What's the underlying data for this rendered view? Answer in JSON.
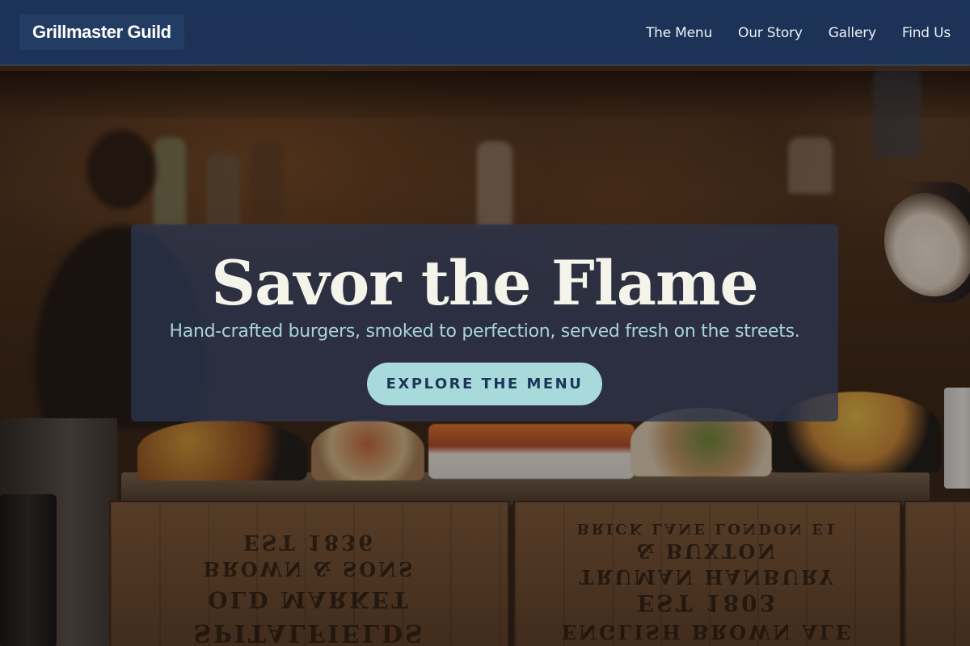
{
  "brand": {
    "name": "Grillmaster Guild"
  },
  "nav": {
    "items": [
      {
        "label": "The Menu"
      },
      {
        "label": "Our Story"
      },
      {
        "label": "Gallery"
      },
      {
        "label": "Find Us"
      }
    ]
  },
  "hero": {
    "title": "Savor the Flame",
    "subtitle": "Hand-crafted burgers, smoked to perfection, served fresh on the streets.",
    "cta_label": "EXPLORE THE MENU"
  },
  "background": {
    "crate_lettering": [
      "EST 1836",
      "BROWN & SONS",
      "OLD MARKET",
      "SPITALFIELDS",
      "BRICK LANE LONDON E1",
      "& BUXTON",
      "TRUMAN HANBURY",
      "EST 1803",
      "ENGLISH BROWN ALE"
    ]
  },
  "colors": {
    "nav_bg": "#1b345c",
    "hero_panel": "#2c344e",
    "title_text": "#f4f4ea",
    "subtitle_text": "#a9d3d7",
    "button_bg": "#a8dadc",
    "button_text": "#1d3557"
  }
}
